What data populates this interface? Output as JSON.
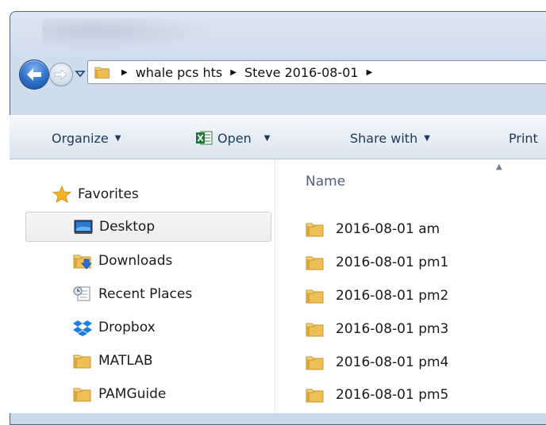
{
  "address_bar": {
    "crumbs": [
      "whale pcs hts",
      "Steve 2016-08-01"
    ]
  },
  "toolbar": {
    "organize": "Organize",
    "open": "Open",
    "share_with": "Share with",
    "print": "Print"
  },
  "nav_pane": {
    "favorites": "Favorites",
    "items": [
      {
        "label": "Desktop",
        "icon": "desktop-icon",
        "selected": true
      },
      {
        "label": "Downloads",
        "icon": "downloads-icon"
      },
      {
        "label": "Recent Places",
        "icon": "recent-places-icon"
      },
      {
        "label": "Dropbox",
        "icon": "dropbox-icon"
      },
      {
        "label": "MATLAB",
        "icon": "folder-icon"
      },
      {
        "label": "PAMGuide",
        "icon": "folder-icon"
      }
    ]
  },
  "content": {
    "column_name": "Name",
    "files": [
      "2016-08-01 am",
      "2016-08-01 pm1",
      "2016-08-01 pm2",
      "2016-08-01 pm3",
      "2016-08-01 pm4",
      "2016-08-01 pm5"
    ]
  },
  "colors": {
    "folder": "#e8b64a",
    "toolbar_text": "#1e395b",
    "back_button": "#2f6fc9"
  }
}
